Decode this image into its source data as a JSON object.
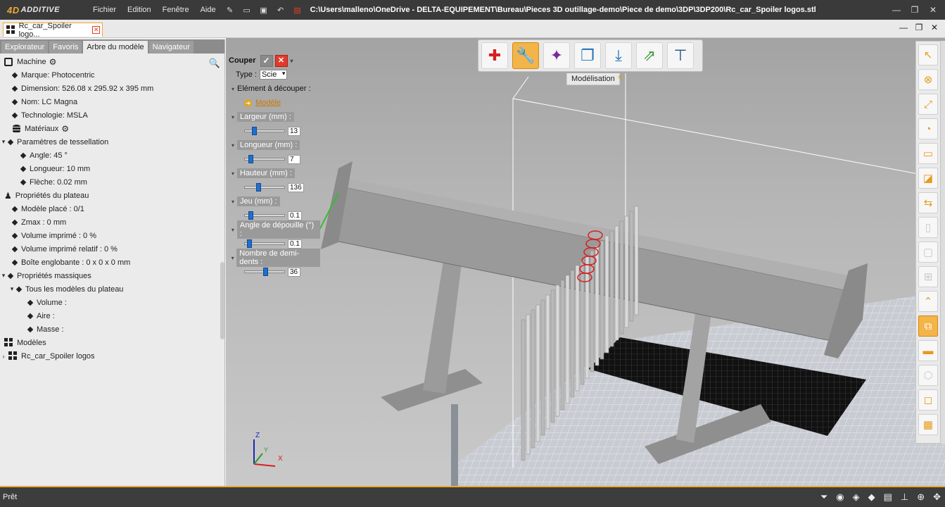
{
  "app": {
    "logo_main": "4D",
    "logo_sub": "ADDITIVE",
    "menu": [
      "Fichier",
      "Edition",
      "Fenêtre",
      "Aide"
    ],
    "file_path": "C:\\Users\\malleno\\OneDrive - DELTA-EQUIPEMENT\\Bureau\\Pieces 3D outillage-demo\\Piece de demo\\3DP\\3DP200\\Rc_car_Spoiler logos.stl"
  },
  "doc_tab": {
    "label": "Rc_car_Spoiler logo..."
  },
  "left_panel": {
    "tabs": [
      "Explorateur",
      "Favoris",
      "Arbre du modèle",
      "Navigateur"
    ],
    "active_tab": "Arbre du modèle",
    "tree": [
      {
        "label": "Machine",
        "level": 0,
        "icon": "machine-icon",
        "gear": true
      },
      {
        "label": "Marque: Photocentric",
        "level": 1
      },
      {
        "label": "Dimension: 526.08 x 295.92 x 395 mm",
        "level": 1
      },
      {
        "label": "Nom: LC Magna",
        "level": 1
      },
      {
        "label": "Technologie: MSLA",
        "level": 1
      },
      {
        "label": "Matériaux",
        "level": 1,
        "icon": "materials-icon",
        "gear": true
      },
      {
        "label": "Paramètres de tessellation",
        "level": 0,
        "expander": "v"
      },
      {
        "label": "Angle: 45 °",
        "level": 2
      },
      {
        "label": "Longueur: 10 mm",
        "level": 2
      },
      {
        "label": "Flèche: 0.02 mm",
        "level": 2
      },
      {
        "label": "Propriétés du plateau",
        "level": 0,
        "icon": "plateau-icon"
      },
      {
        "label": "Modèle placé : 0/1",
        "level": 1
      },
      {
        "label": "Zmax : 0 mm",
        "level": 1
      },
      {
        "label": "Volume imprimé : 0 %",
        "level": 1
      },
      {
        "label": "Volume imprimé relatif : 0 %",
        "level": 1
      },
      {
        "label": "Boîte englobante : 0 x 0 x 0 mm",
        "level": 1
      },
      {
        "label": "Propriétés massiques",
        "level": 0,
        "expander": "v"
      },
      {
        "label": "Tous les modèles du plateau",
        "level": 1,
        "expander": "v"
      },
      {
        "label": "Volume :",
        "level": 3
      },
      {
        "label": "Aire :",
        "level": 3
      },
      {
        "label": "Masse :",
        "level": 3
      },
      {
        "label": "Modèles",
        "level": 0,
        "icon": "models-icon"
      },
      {
        "label": "Rc_car_Spoiler logos",
        "level": 0,
        "icon": "models-icon",
        "expander": ">"
      }
    ]
  },
  "cut_panel": {
    "title": "Couper",
    "type_label": "Type :",
    "type_value": "Scie",
    "element_label": "Elément à découper :",
    "element_value": "Modèle",
    "params": [
      {
        "label": "Largeur (mm) :",
        "value": "13",
        "level": 0.2
      },
      {
        "label": "Longueur (mm) :",
        "value": "7",
        "level": 0.1
      },
      {
        "label": "Hauteur (mm) :",
        "value": "136",
        "level": 0.3
      },
      {
        "label": "Jeu (mm) :",
        "value": "0.1",
        "level": 0.1
      },
      {
        "label": "Angle de dépouille (°) :",
        "value": "0.1",
        "level": 0.05
      },
      {
        "label": "Nombre de demi-dents :",
        "value": "36",
        "level": 0.5
      }
    ]
  },
  "top_toolbar": {
    "label": "Modélisation",
    "buttons": [
      {
        "name": "add-button",
        "icon": "plus-icon",
        "glyph": "✚",
        "color": "#d62020"
      },
      {
        "name": "repair-button",
        "icon": "wrench-icon",
        "glyph": "🔧",
        "color": "#ffffff",
        "active": true
      },
      {
        "name": "magic-button",
        "icon": "sparkle-icon",
        "glyph": "✦",
        "color": "#7a2a9a"
      },
      {
        "name": "duplicate-button",
        "icon": "copy-icon",
        "glyph": "❐",
        "color": "#1f6fb8"
      },
      {
        "name": "import-button",
        "icon": "download-icon",
        "glyph": "⤓",
        "color": "#1f6fb8"
      },
      {
        "name": "export-button",
        "icon": "export-icon",
        "glyph": "⇗",
        "color": "#3a9a3a"
      },
      {
        "name": "measure-button",
        "icon": "caliper-icon",
        "glyph": "⊤",
        "color": "#1f4f8a"
      }
    ]
  },
  "right_toolbar": [
    {
      "icon": "pointer-icon",
      "glyph": "↖",
      "state": "normal"
    },
    {
      "icon": "cancel-circle-icon",
      "glyph": "⊗",
      "state": "normal"
    },
    {
      "icon": "scale-icon",
      "glyph": "⤢",
      "state": "normal"
    },
    {
      "icon": "rotate-icon",
      "glyph": "◔",
      "state": "normal"
    },
    {
      "icon": "frame-icon",
      "glyph": "▭",
      "state": "normal"
    },
    {
      "icon": "measure-angle-icon",
      "glyph": "◪",
      "state": "normal"
    },
    {
      "icon": "move-icon",
      "glyph": "⇆",
      "state": "normal"
    },
    {
      "icon": "split-icon",
      "glyph": "▯",
      "state": "dim"
    },
    {
      "icon": "page-icon",
      "glyph": "▢",
      "state": "dim"
    },
    {
      "icon": "arrange-icon",
      "glyph": "⊞",
      "state": "dim"
    },
    {
      "icon": "support-icon",
      "glyph": "⌃",
      "state": "normal"
    },
    {
      "icon": "cut-icon",
      "glyph": "⧉",
      "state": "on"
    },
    {
      "icon": "plateau-icon",
      "glyph": "▬",
      "state": "normal"
    },
    {
      "icon": "hollow-icon",
      "glyph": "⬡",
      "state": "dim"
    },
    {
      "icon": "box-icon",
      "glyph": "◻",
      "state": "normal"
    },
    {
      "icon": "grid-icon",
      "glyph": "▦",
      "state": "normal"
    }
  ],
  "axes": {
    "x": "X",
    "y": "Y",
    "z": "Z"
  },
  "status": {
    "text": "Prêt"
  },
  "colors": {
    "accent": "#f0a830",
    "selection_red": "#d62020",
    "slider_blue": "#1f6fd0"
  }
}
